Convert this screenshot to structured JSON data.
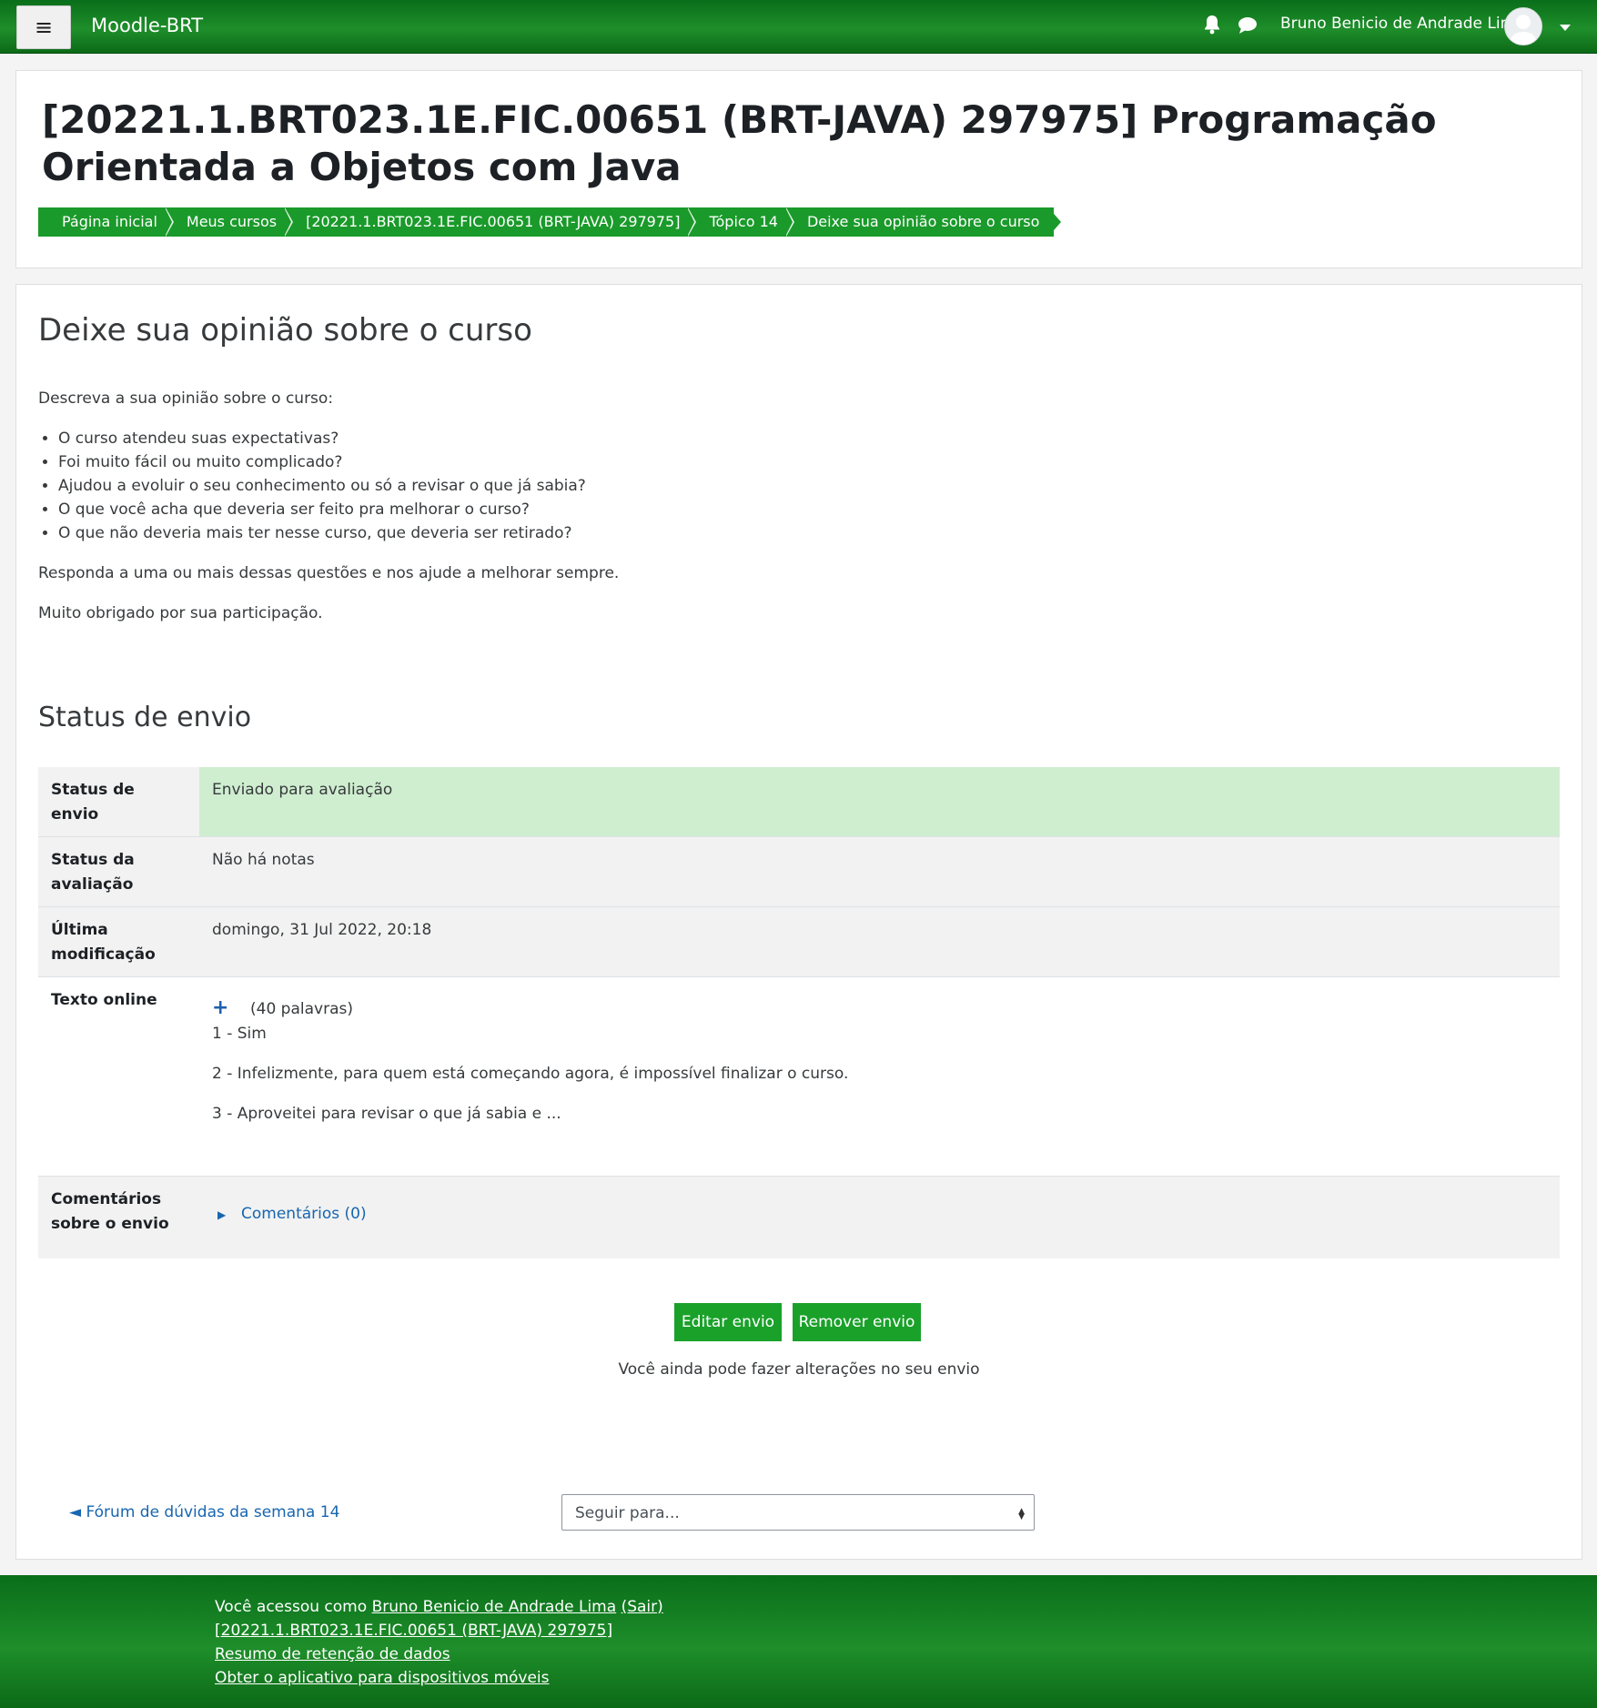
{
  "navbar": {
    "menu_icon": "≡",
    "brand": "Moodle-BRT",
    "username": "Bruno Benicio de Andrade Lima"
  },
  "header": {
    "course_title": "[20221.1.BRT023.1E.FIC.00651 (BRT-JAVA) 297975] Programação Orientada a Objetos com Java",
    "breadcrumb": [
      "Página inicial",
      "Meus cursos",
      "[20221.1.BRT023.1E.FIC.00651 (BRT-JAVA) 297975]",
      "Tópico 14",
      "Deixe sua opinião sobre o curso"
    ]
  },
  "activity": {
    "title": "Deixe sua opinião sobre o curso",
    "intro": "Descreva a sua opinião sobre o curso:",
    "questions": [
      "O curso atendeu suas expectativas?",
      "Foi muito fácil ou muito complicado?",
      "Ajudou a evoluir o seu conhecimento ou só a revisar o que já sabia?",
      "O que você acha que deveria ser feito pra melhorar o curso?",
      "O que não deveria mais ter nesse curso, que deveria ser retirado?"
    ],
    "closing1": "Responda a uma ou mais dessas questões e nos ajude a melhorar sempre.",
    "closing2": "Muito obrigado por sua participação."
  },
  "submission": {
    "heading": "Status de envio",
    "rows": {
      "status_label": "Status de envio",
      "status_value": "Enviado para avaliação",
      "grading_label": "Status da avaliação",
      "grading_value": "Não há notas",
      "modified_label": "Última modificação",
      "modified_value": "domingo, 31 Jul 2022, 20:18",
      "online_label": "Texto online",
      "online_plus": "+",
      "online_words": "(40 palavras)",
      "online_lines": [
        "1 - Sim",
        "2 - Infelizmente, para quem está começando agora, é impossível finalizar o curso.",
        "3 - Aproveitei para revisar o que já sabia e ..."
      ],
      "comments_label": "Comentários sobre o envio",
      "comments_link": "Comentários (0)"
    },
    "edit_button": "Editar envio",
    "remove_button": "Remover envio",
    "still_edit_note": "Você ainda pode fazer alterações no seu envio"
  },
  "navigation": {
    "prev_link": "◄ Fórum de dúvidas da semana 14",
    "jump_placeholder": "Seguir para..."
  },
  "footer": {
    "logged_in_prefix": "Você acessou como ",
    "user_link": "Bruno Benicio de Andrade Lima",
    "logout_link": "(Sair)",
    "course_link": "[20221.1.BRT023.1E.FIC.00651 (BRT-JAVA) 297975]",
    "data_retention_link": "Resumo de retenção de dados",
    "mobile_app_link": "Obter o aplicativo para dispositivos móveis"
  }
}
